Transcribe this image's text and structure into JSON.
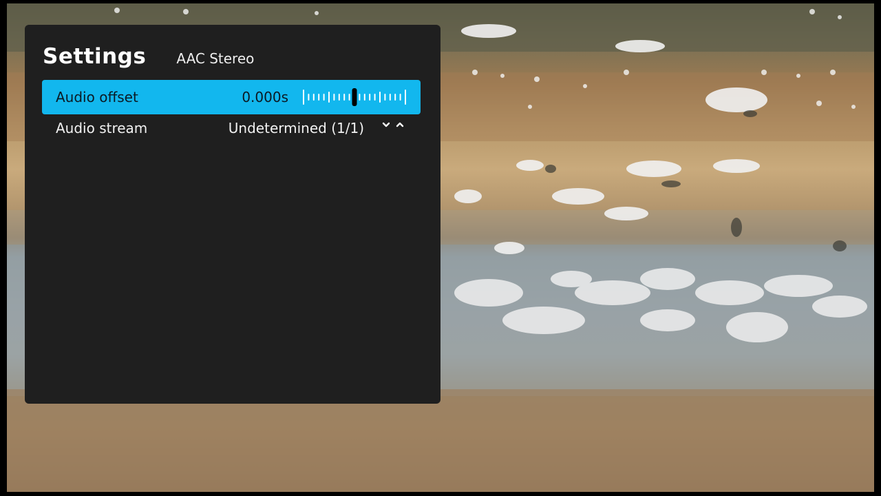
{
  "settings": {
    "title": "Settings",
    "subtitle": "AAC Stereo",
    "rows": [
      {
        "label": "Audio offset",
        "value": "0.000s",
        "slider_level": 0.5
      },
      {
        "label": "Audio stream",
        "value": "Undetermined (1/1)"
      }
    ]
  },
  "colors": {
    "panel_bg": "#1f1f1f",
    "accent": "#12b7ee",
    "text": "#f2f2f2"
  },
  "icons": [
    "chevron-down-icon",
    "chevron-up-icon"
  ]
}
